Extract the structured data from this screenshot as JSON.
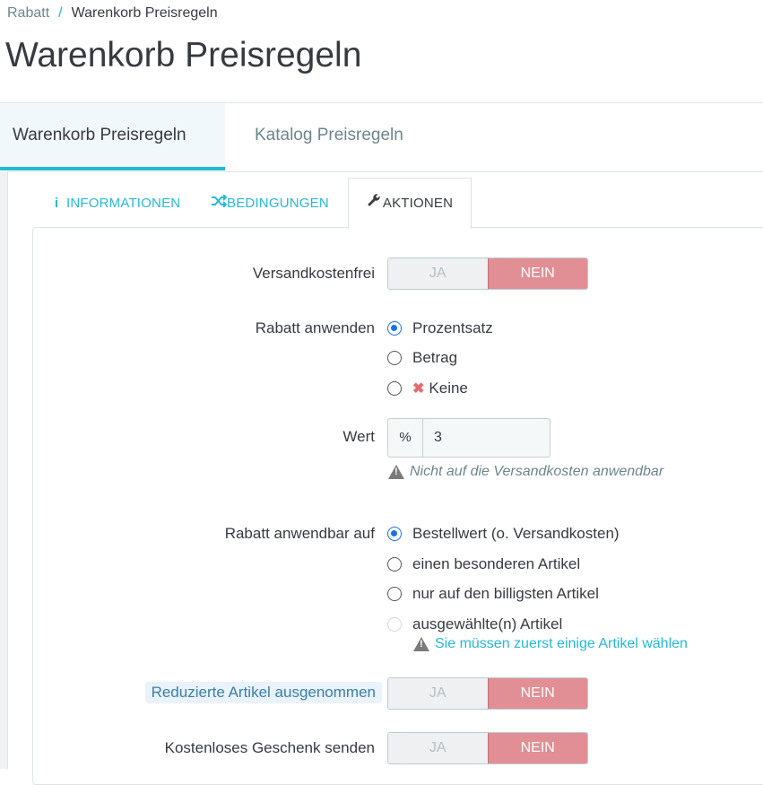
{
  "breadcrumb": {
    "parent": "Rabatt",
    "separator": "/",
    "current": "Warenkorb Preisregeln"
  },
  "page_title": "Warenkorb Preisregeln",
  "top_tabs": [
    {
      "label": "Warenkorb Preisregeln",
      "active": true
    },
    {
      "label": "Katalog Preisregeln",
      "active": false
    }
  ],
  "inner_tabs": [
    {
      "label": "INFORMATIONEN",
      "icon": "info-icon"
    },
    {
      "label": "BEDINGUNGEN",
      "icon": "shuffle-icon"
    },
    {
      "label": "AKTIONEN",
      "icon": "wrench-icon",
      "active": true
    }
  ],
  "form": {
    "free_shipping": {
      "label": "Versandkostenfrei",
      "yes": "JA",
      "no": "NEIN",
      "selected": "NEIN"
    },
    "apply_discount": {
      "label": "Rabatt anwenden",
      "options": [
        "Prozentsatz",
        "Betrag",
        "Keine"
      ],
      "selected": "Prozentsatz"
    },
    "value": {
      "label": "Wert",
      "addon": "%",
      "value": "3",
      "help": "Nicht auf die Versandkosten anwendbar"
    },
    "apply_to": {
      "label": "Rabatt anwendbar auf",
      "options": [
        "Bestellwert (o. Versandkosten)",
        "einen besonderen Artikel",
        "nur auf den billigsten Artikel",
        "ausgewählte(n) Artikel"
      ],
      "selected": "Bestellwert (o. Versandkosten)",
      "warning": "Sie müssen zuerst einige Artikel wählen"
    },
    "exclude_discounted": {
      "label": "Reduzierte Artikel ausgenommen",
      "yes": "JA",
      "no": "NEIN",
      "selected": "NEIN"
    },
    "free_gift": {
      "label": "Kostenloses Geschenk senden",
      "yes": "JA",
      "no": "NEIN",
      "selected": "NEIN"
    }
  },
  "colors": {
    "accent": "#25b9d7",
    "toggle_no": "#e18f94",
    "radio": "#1a73e8"
  }
}
